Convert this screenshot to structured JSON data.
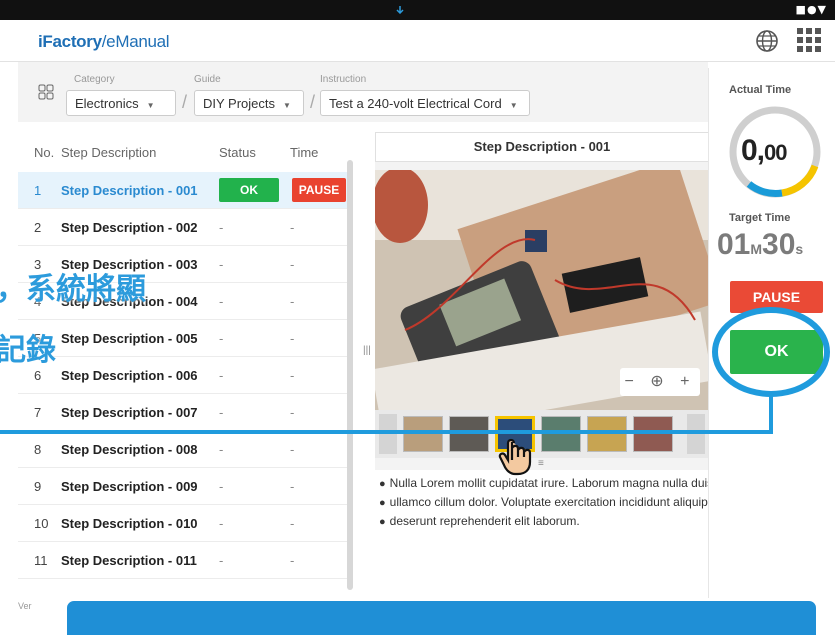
{
  "status": {
    "icons": "■●▼"
  },
  "app": {
    "brand_main": "iFactory",
    "brand_sep": "/",
    "brand_sub": "eManual"
  },
  "selectors": {
    "category_label": "Category",
    "category_value": "Electronics",
    "guide_label": "Guide",
    "guide_value": "DIY Projects",
    "instruction_label": "Instruction",
    "instruction_value": "Test a 240-volt Electrical Cord"
  },
  "list": {
    "headers": {
      "no": "No.",
      "desc": "Step Description",
      "status": "Status",
      "time": "Time"
    },
    "rows": [
      {
        "no": "1",
        "desc": "Step Description - 001",
        "status": "OK",
        "time": "PAUSE"
      },
      {
        "no": "2",
        "desc": "Step Description - 002",
        "status": "-",
        "time": "-"
      },
      {
        "no": "3",
        "desc": "Step Description - 003",
        "status": "-",
        "time": "-"
      },
      {
        "no": "4",
        "desc": "Step Description - 004",
        "status": "-",
        "time": "-"
      },
      {
        "no": "5",
        "desc": "Step Description - 005",
        "status": "-",
        "time": "-"
      },
      {
        "no": "6",
        "desc": "Step Description - 006",
        "status": "-",
        "time": "-"
      },
      {
        "no": "7",
        "desc": "Step Description - 007",
        "status": "-",
        "time": "-"
      },
      {
        "no": "8",
        "desc": "Step Description - 008",
        "status": "-",
        "time": "-"
      },
      {
        "no": "9",
        "desc": "Step Description - 009",
        "status": "-",
        "time": "-"
      },
      {
        "no": "10",
        "desc": "Step Description - 010",
        "status": "-",
        "time": "-"
      },
      {
        "no": "11",
        "desc": "Step Description - 011",
        "status": "-",
        "time": "-"
      }
    ],
    "version": "Ver"
  },
  "detail": {
    "title": "Step Description - 001",
    "zoom": "− ⊕ +",
    "thumb_selected_label": "",
    "bullets": [
      "Nulla Lorem mollit cupidatat irure. Laborum magna nulla duis",
      "ullamco cillum dolor. Voluptate exercitation incididunt aliquip",
      "deserunt reprehenderit elit laborum."
    ]
  },
  "timer": {
    "actual_label": "Actual Time",
    "actual_main": "0,",
    "actual_dec": "00",
    "target_label": "Target Time",
    "target_min": "01",
    "target_min_unit": "M",
    "target_sec": "30",
    "target_sec_unit": "s",
    "pause": "PAUSE",
    "ok": "OK"
  },
  "overlay": {
    "line1": "，系統將顯",
    "line2": "記錄"
  },
  "colors": {
    "accent": "#1f8fd6",
    "ok": "#22b24c",
    "pause": "#e9432f",
    "brand": "#1f6fb5"
  }
}
